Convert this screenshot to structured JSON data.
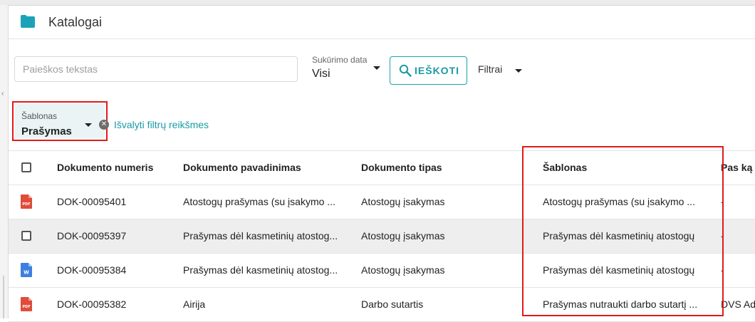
{
  "header": {
    "title": "Katalogai",
    "icon": "folder-icon"
  },
  "search": {
    "placeholder": "Paieškos tekstas",
    "value": ""
  },
  "date_filter": {
    "label": "Sukūrimo data",
    "value": "Visi"
  },
  "search_button": {
    "label": "IEŠKOTI"
  },
  "filters_button": {
    "label": "Filtrai"
  },
  "template_filter": {
    "label": "Šablonas",
    "value": "Prašymas"
  },
  "clear_filters_link": "Išvalyti filtrų reikšmes",
  "table": {
    "columns": [
      "Dokumento numeris",
      "Dokumento pavadinimas",
      "Dokumento tipas",
      "Šablonas",
      "Pas ką d"
    ],
    "rows": [
      {
        "icon": "pdf-file-icon",
        "number": "DOK-00095401",
        "name": "Atostogų prašymas (su įsakymo ...",
        "type": "Atostogų įsakymas",
        "template": "Atostogų prašymas (su įsakymo ...",
        "holder": "-"
      },
      {
        "icon": "checkbox",
        "number": "DOK-00095397",
        "name": "Prašymas dėl kasmetinių atostog...",
        "type": "Atostogų įsakymas",
        "template": "Prašymas dėl kasmetinių atostogų",
        "holder": "-"
      },
      {
        "icon": "word-file-icon",
        "number": "DOK-00095384",
        "name": "Prašymas dėl kasmetinių atostog...",
        "type": "Atostogų įsakymas",
        "template": "Prašymas dėl kasmetinių atostogų",
        "holder": "-"
      },
      {
        "icon": "pdf-file-icon",
        "number": "DOK-00095382",
        "name": "Airija",
        "type": "Darbo sutartis",
        "template": "Prašymas nutraukti darbo sutartį ...",
        "holder": "DVS Ad"
      }
    ]
  },
  "colors": {
    "accent": "#1a9aa5",
    "highlight": "#e01b1b",
    "pdf": "#e04b3a",
    "word": "#3d7fe0"
  }
}
